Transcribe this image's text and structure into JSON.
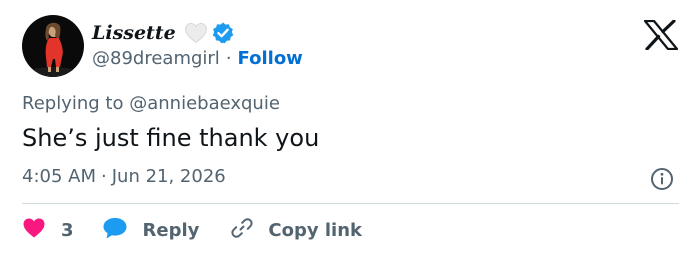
{
  "author": {
    "display_name": "Lissette",
    "handle": "@89dreamgirl",
    "separator": "·",
    "follow_label": "Follow"
  },
  "tweet": {
    "replying_prefix": "Replying to",
    "replying_to": "@anniebaexquie",
    "text": "She’s just fine thank you",
    "time": "4:05 AM",
    "separator": "·",
    "date": "Jun 21, 2026"
  },
  "actions": {
    "like_count": "3",
    "reply_label": "Reply",
    "copy_label": "Copy link"
  },
  "icons": {
    "brand": "x-logo",
    "badge": "verified-badge-icon",
    "emoji": "white-heart-emoji",
    "info": "info-icon",
    "like": "heart-icon",
    "reply": "speech-bubble-icon",
    "copy": "link-icon"
  },
  "colors": {
    "text": "#0f1419",
    "secondary": "#536471",
    "link": "#006fd6",
    "verified": "#1d9bf0",
    "like": "#f91880",
    "divider": "#cfd9de"
  }
}
